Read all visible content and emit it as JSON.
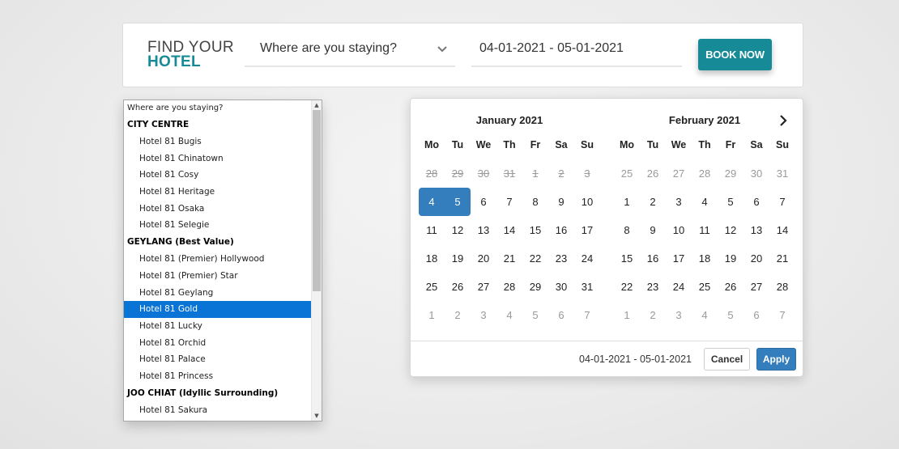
{
  "brand": {
    "line1": "FIND YOUR",
    "line2": "HOTEL"
  },
  "search": {
    "location_value": "Where are you staying?",
    "dates_value": "04-01-2021 - 05-01-2021",
    "book_label": "BOOK NOW"
  },
  "dropdown": {
    "placeholder": "Where are you staying?",
    "groups": [
      {
        "label": "CITY CENTRE",
        "options": [
          "Hotel 81 Bugis",
          "Hotel 81 Chinatown",
          "Hotel 81 Cosy",
          "Hotel 81 Heritage",
          "Hotel 81 Osaka",
          "Hotel 81 Selegie"
        ]
      },
      {
        "label": "GEYLANG (Best Value)",
        "options": [
          "Hotel 81 (Premier) Hollywood",
          "Hotel 81 (Premier) Star",
          "Hotel 81 Geylang",
          "Hotel 81 Gold",
          "Hotel 81 Lucky",
          "Hotel 81 Orchid",
          "Hotel 81 Palace",
          "Hotel 81 Princess"
        ]
      },
      {
        "label": "JOO CHIAT (Idyllic Surrounding)",
        "options": [
          "Hotel 81 Sakura"
        ]
      }
    ],
    "selected": "Hotel 81 Gold"
  },
  "calendar": {
    "weekdays": [
      "Mo",
      "Tu",
      "We",
      "Th",
      "Fr",
      "Sa",
      "Su"
    ],
    "months": [
      {
        "title": "January 2021",
        "days": [
          {
            "d": "28",
            "s": "disabled"
          },
          {
            "d": "29",
            "s": "disabled"
          },
          {
            "d": "30",
            "s": "disabled"
          },
          {
            "d": "31",
            "s": "disabled"
          },
          {
            "d": "1",
            "s": "disabled"
          },
          {
            "d": "2",
            "s": "disabled"
          },
          {
            "d": "3",
            "s": "disabled"
          },
          {
            "d": "4",
            "s": "sel-start"
          },
          {
            "d": "5",
            "s": "sel-end"
          },
          {
            "d": "6",
            "s": ""
          },
          {
            "d": "7",
            "s": ""
          },
          {
            "d": "8",
            "s": ""
          },
          {
            "d": "9",
            "s": ""
          },
          {
            "d": "10",
            "s": ""
          },
          {
            "d": "11",
            "s": ""
          },
          {
            "d": "12",
            "s": ""
          },
          {
            "d": "13",
            "s": ""
          },
          {
            "d": "14",
            "s": ""
          },
          {
            "d": "15",
            "s": ""
          },
          {
            "d": "16",
            "s": ""
          },
          {
            "d": "17",
            "s": ""
          },
          {
            "d": "18",
            "s": ""
          },
          {
            "d": "19",
            "s": ""
          },
          {
            "d": "20",
            "s": ""
          },
          {
            "d": "21",
            "s": ""
          },
          {
            "d": "22",
            "s": ""
          },
          {
            "d": "23",
            "s": ""
          },
          {
            "d": "24",
            "s": ""
          },
          {
            "d": "25",
            "s": ""
          },
          {
            "d": "26",
            "s": ""
          },
          {
            "d": "27",
            "s": ""
          },
          {
            "d": "28",
            "s": ""
          },
          {
            "d": "29",
            "s": ""
          },
          {
            "d": "30",
            "s": ""
          },
          {
            "d": "31",
            "s": ""
          },
          {
            "d": "1",
            "s": "off"
          },
          {
            "d": "2",
            "s": "off"
          },
          {
            "d": "3",
            "s": "off"
          },
          {
            "d": "4",
            "s": "off"
          },
          {
            "d": "5",
            "s": "off"
          },
          {
            "d": "6",
            "s": "off"
          },
          {
            "d": "7",
            "s": "off"
          }
        ]
      },
      {
        "title": "February 2021",
        "days": [
          {
            "d": "25",
            "s": "off"
          },
          {
            "d": "26",
            "s": "off"
          },
          {
            "d": "27",
            "s": "off"
          },
          {
            "d": "28",
            "s": "off"
          },
          {
            "d": "29",
            "s": "off"
          },
          {
            "d": "30",
            "s": "off"
          },
          {
            "d": "31",
            "s": "off"
          },
          {
            "d": "1",
            "s": ""
          },
          {
            "d": "2",
            "s": ""
          },
          {
            "d": "3",
            "s": ""
          },
          {
            "d": "4",
            "s": ""
          },
          {
            "d": "5",
            "s": ""
          },
          {
            "d": "6",
            "s": ""
          },
          {
            "d": "7",
            "s": ""
          },
          {
            "d": "8",
            "s": ""
          },
          {
            "d": "9",
            "s": ""
          },
          {
            "d": "10",
            "s": ""
          },
          {
            "d": "11",
            "s": ""
          },
          {
            "d": "12",
            "s": ""
          },
          {
            "d": "13",
            "s": ""
          },
          {
            "d": "14",
            "s": ""
          },
          {
            "d": "15",
            "s": ""
          },
          {
            "d": "16",
            "s": ""
          },
          {
            "d": "17",
            "s": ""
          },
          {
            "d": "18",
            "s": ""
          },
          {
            "d": "19",
            "s": ""
          },
          {
            "d": "20",
            "s": ""
          },
          {
            "d": "21",
            "s": ""
          },
          {
            "d": "22",
            "s": ""
          },
          {
            "d": "23",
            "s": ""
          },
          {
            "d": "24",
            "s": ""
          },
          {
            "d": "25",
            "s": ""
          },
          {
            "d": "26",
            "s": ""
          },
          {
            "d": "27",
            "s": ""
          },
          {
            "d": "28",
            "s": ""
          },
          {
            "d": "1",
            "s": "off"
          },
          {
            "d": "2",
            "s": "off"
          },
          {
            "d": "3",
            "s": "off"
          },
          {
            "d": "4",
            "s": "off"
          },
          {
            "d": "5",
            "s": "off"
          },
          {
            "d": "6",
            "s": "off"
          },
          {
            "d": "7",
            "s": "off"
          }
        ]
      }
    ],
    "range_text": "04-01-2021 - 05-01-2021",
    "cancel_label": "Cancel",
    "apply_label": "Apply"
  },
  "colors": {
    "brand_teal": "#168a96",
    "apply_blue": "#357ebd",
    "select_blue": "#0a74d6"
  }
}
